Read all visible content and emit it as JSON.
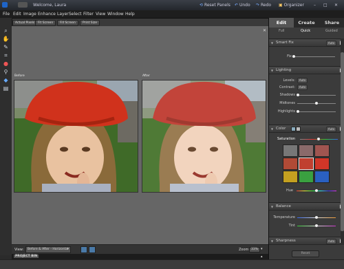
{
  "titlebar": {
    "welcome": "Welcome, Laura",
    "reset_panels": "Reset Panels",
    "undo": "Undo",
    "redo": "Redo",
    "organizer": "Organizer"
  },
  "menu": [
    "File",
    "Edit",
    "Image",
    "Enhance",
    "Layer",
    "Select",
    "Filter",
    "View",
    "Window",
    "Help"
  ],
  "options": [
    "Actual Pixels",
    "Fit Screen",
    "Fill Screen",
    "Print Size"
  ],
  "canvas": {
    "before_label": "Before",
    "after_label": "After"
  },
  "viewbar": {
    "view_label": "View:",
    "view_value": "Before & After - Horizontal",
    "zoom_label": "Zoom:",
    "zoom_value": "33%"
  },
  "project_bin": "PROJECT BIN",
  "panel": {
    "tabs": [
      "Edit",
      "Create",
      "Share"
    ],
    "subtabs": [
      "Full",
      "Quick",
      "Guided"
    ],
    "sections": {
      "smart_fix": "Smart Fix",
      "lighting": "Lighting",
      "color": "Color",
      "balance": "Balance",
      "sharpness": "Sharpness"
    },
    "auto": "Auto",
    "fix": "Fix",
    "levels": "Levels:",
    "contrast": "Contrast:",
    "shadows": "Shadows",
    "midtones": "Midtones",
    "highlights": "Highlights",
    "saturation": "Saturation",
    "hue": "Hue",
    "temperature": "Temperature",
    "tint": "Tint",
    "reset": "Reset"
  }
}
